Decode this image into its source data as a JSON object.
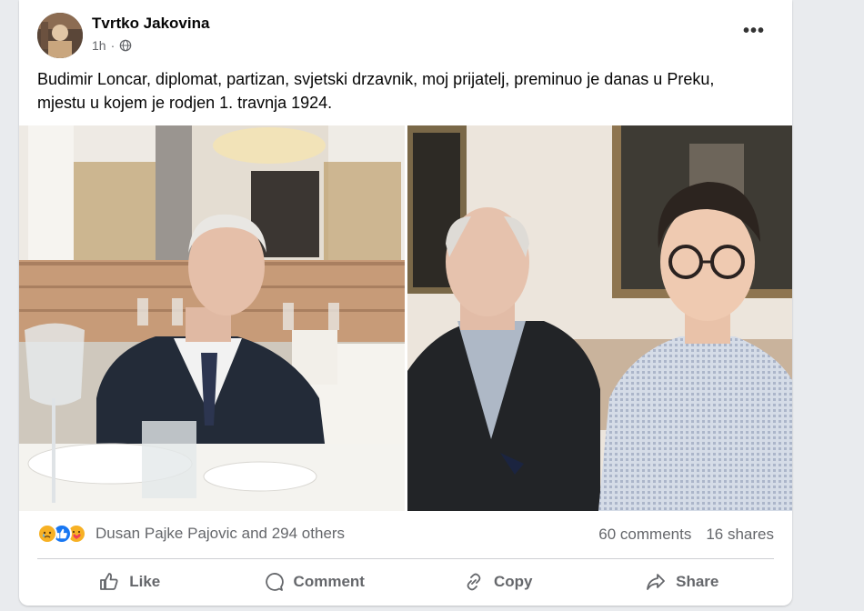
{
  "post": {
    "author": "Tvrtko Jakovina",
    "time": "1h",
    "privacy_icon": "globe-icon",
    "more_label": "•••",
    "text": "Budimir Loncar, diplomat, partizan, svjetski drzavnik, moj prijatelj, preminuo je danas u Preku, mjestu u kojem je rodjen 1. travnja 1924."
  },
  "reactions": {
    "icons": [
      "sad-reaction-icon",
      "like-reaction-icon",
      "care-reaction-icon"
    ],
    "summary": "Dusan Pajke Pajovic and 294 others",
    "comments": "60 comments",
    "shares": "16 shares"
  },
  "actions": {
    "like": "Like",
    "comment": "Comment",
    "copy": "Copy",
    "share": "Share"
  },
  "colors": {
    "accent": "#1877f2",
    "secondary_text": "#65676b",
    "background": "#e9ebee"
  }
}
